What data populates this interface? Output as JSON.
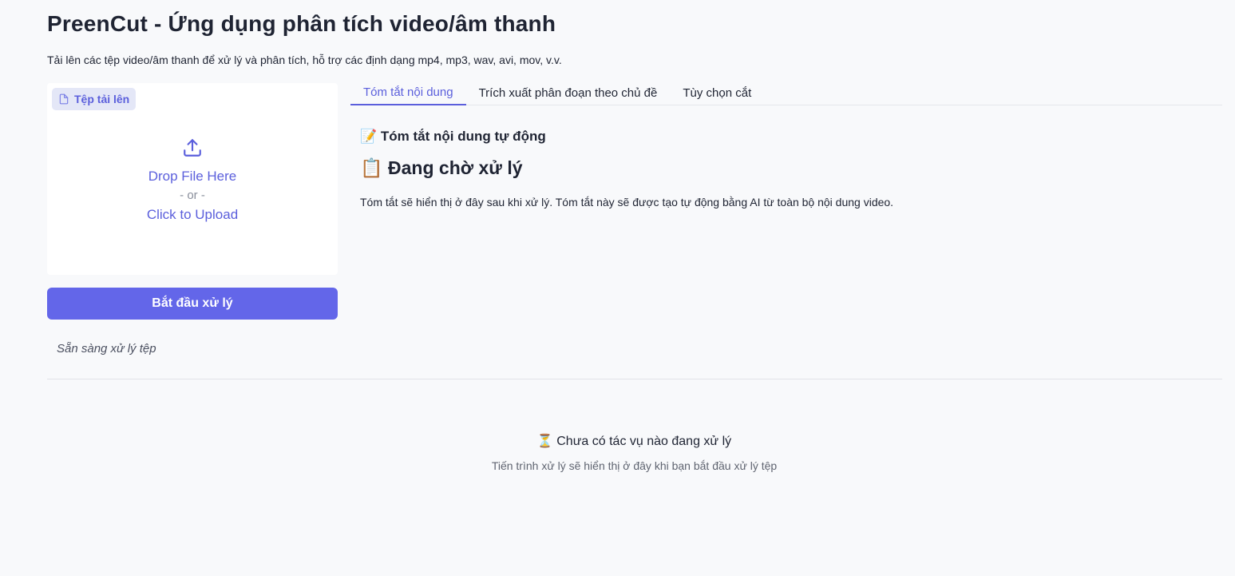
{
  "header": {
    "title": "PreenCut - Ứng dụng phân tích video/âm thanh",
    "subtitle": "Tải lên các tệp video/âm thanh để xử lý và phân tích, hỗ trợ các định dạng mp4, mp3, wav, avi, mov, v.v."
  },
  "upload": {
    "label": "Tệp tải lên",
    "icon": "file-icon",
    "upload_icon": "upload-icon",
    "drop_text": "Drop File Here",
    "or_text": "- or -",
    "click_text": "Click to Upload"
  },
  "actions": {
    "start_label": "Bắt đầu xử lý"
  },
  "status": {
    "text": "Sẵn sàng xử lý tệp"
  },
  "tabs": [
    {
      "label": "Tóm tắt nội dung",
      "active": true
    },
    {
      "label": "Trích xuất phân đoạn theo chủ đề",
      "active": false
    },
    {
      "label": "Tùy chọn cắt",
      "active": false
    }
  ],
  "summary": {
    "heading_emoji": "📝",
    "heading": "Tóm tắt nội dung tự động",
    "waiting_emoji": "📋",
    "waiting_heading": "Đang chờ xử lý",
    "description": "Tóm tắt sẽ hiển thị ở đây sau khi xử lý. Tóm tắt này sẽ được tạo tự động bằng AI từ toàn bộ nội dung video."
  },
  "progress": {
    "emoji": "⏳",
    "title": "Chưa có tác vụ nào đang xử lý",
    "description": "Tiến trình xử lý sẽ hiển thị ở đây khi bạn bắt đầu xử lý tệp"
  },
  "colors": {
    "accent": "#6366e9",
    "accent_text": "#5b5fdc",
    "background": "#f8f9fb"
  }
}
